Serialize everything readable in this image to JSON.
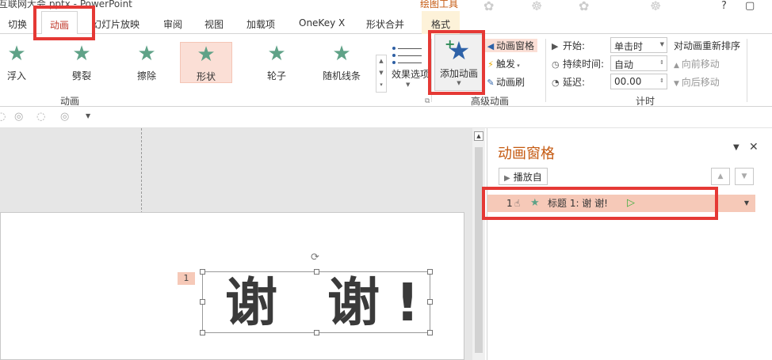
{
  "window": {
    "title": "互联网大会.pptx - PowerPoint",
    "context_tab": "绘图工具",
    "help": "?"
  },
  "tabs": [
    "切换",
    "动画",
    "幻灯片放映",
    "审阅",
    "视图",
    "加载项",
    "OneKey X",
    "形状合并",
    "格式"
  ],
  "ribbon": {
    "effects": [
      "浮入",
      "劈裂",
      "擦除",
      "形状",
      "轮子",
      "随机线条"
    ],
    "effect_options": "效果选项",
    "group_animation": "动画",
    "add_animation": "添加动画",
    "animation_pane": "动画窗格",
    "trigger": "触发",
    "animation_painter": "动画刷",
    "group_advanced": "高级动画",
    "start_label": "开始:",
    "start_value": "单击时",
    "duration_label": "持续时间:",
    "duration_value": "自动",
    "delay_label": "延迟:",
    "delay_value": "00.00",
    "group_timing": "计时",
    "reorder_title": "对动画重新排序",
    "move_earlier": "向前移动",
    "move_later": "向后移动"
  },
  "slide": {
    "anim_number": "1",
    "text": "谢 谢!"
  },
  "pane": {
    "title": "动画窗格",
    "play_from": "播放自",
    "item": {
      "number": "1",
      "label": "标题 1: 谢 谢!"
    }
  },
  "colors": {
    "accent": "#c55a11",
    "selection": "#f6c9b8",
    "annotation": "#e53935"
  }
}
